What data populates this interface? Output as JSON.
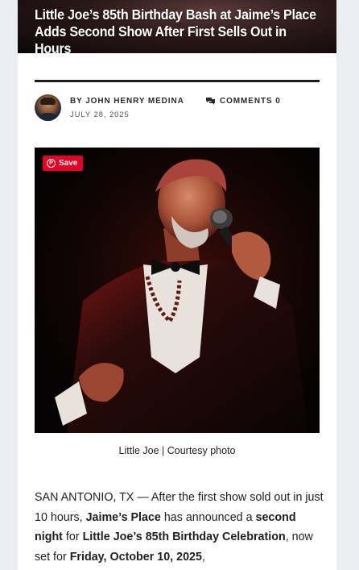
{
  "hero": {
    "title": "Little Joe’s 85th Birthday Bash at Jaime’s Place Adds Second Show After First Sells Out in Hours"
  },
  "meta": {
    "byline": "BY JOHN HENRY MEDINA",
    "date": "JULY 28, 2025",
    "comments": "COMMENTS 0",
    "comments_icon": "comment-bubbles-icon"
  },
  "photo": {
    "pin_label": "Save",
    "pin_icon": "pinterest-icon",
    "caption": "Little Joe | Courtesy photo"
  },
  "article": {
    "p1_a": "SAN ANTONIO, TX — After the first show sold out in just 10 hours, ",
    "p1_b": "Jaime’s Place",
    "p1_c": " has announced a ",
    "p1_d": "second night",
    "p1_e": " for ",
    "p1_f": "Little Joe’s 85th Birthday Celebration",
    "p1_g": ", now set for ",
    "p1_h": "Friday, October 10, 2025",
    "p1_i": ","
  },
  "colors": {
    "accent": "#e60023",
    "rule": "#1c1c1c",
    "background": "#ebedf2"
  }
}
